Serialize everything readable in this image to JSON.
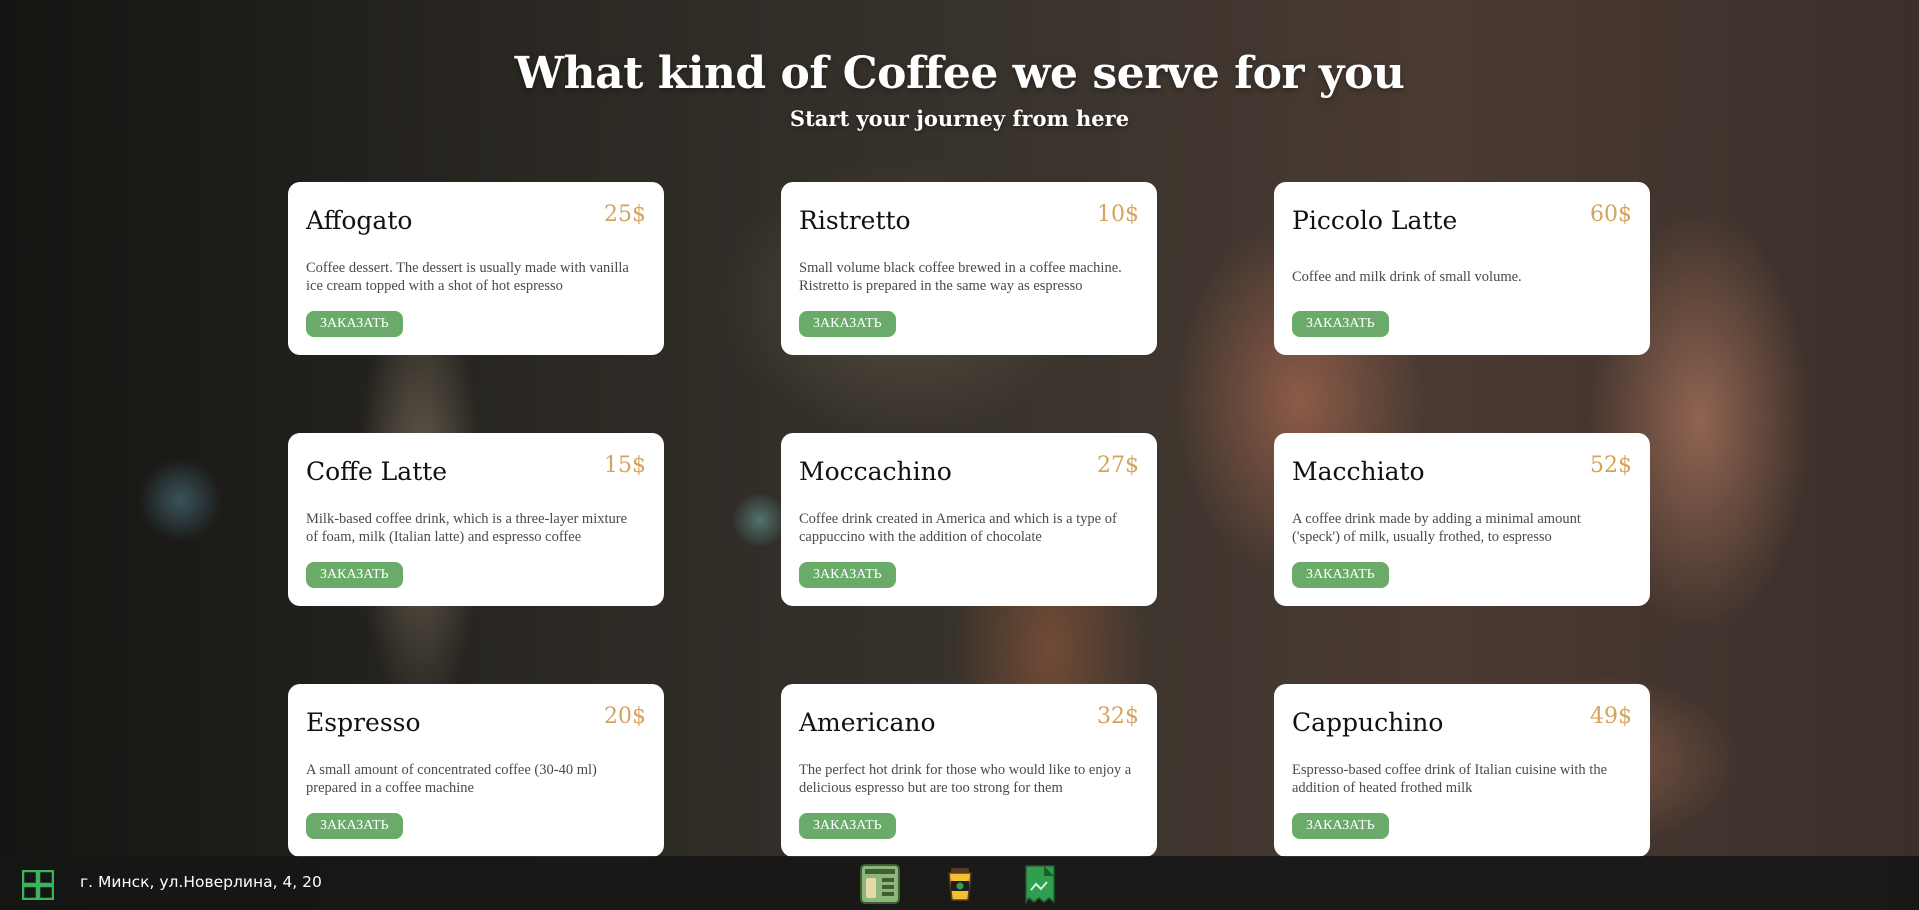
{
  "hero": {
    "title": "What kind of Coffee we serve for you",
    "subtitle": "Start your journey from here"
  },
  "menu": [
    {
      "name": "Affogato",
      "price": "25$",
      "description": "Coffee dessert. The dessert is usually made with vanilla ice cream topped with a shot of hot espresso",
      "button": "ЗАКАЗАТЬ"
    },
    {
      "name": "Ristretto",
      "price": "10$",
      "description": "Small volume black coffee brewed in a coffee machine. Ristretto is prepared in the same way as espresso",
      "button": "ЗАКАЗАТЬ"
    },
    {
      "name": "Piccolo Latte",
      "price": "60$",
      "description": "Coffee and milk drink of small volume.",
      "button": "ЗАКАЗАТЬ"
    },
    {
      "name": "Coffe Latte",
      "price": "15$",
      "description": "Milk-based coffee drink, which is a three-layer mixture of foam, milk (Italian latte) and espresso coffee",
      "button": "ЗАКАЗАТЬ"
    },
    {
      "name": "Moccachino",
      "price": "27$",
      "description": "Coffee drink created in America and which is a type of cappuccino with the addition of chocolate",
      "button": "ЗАКАЗАТЬ"
    },
    {
      "name": "Macchiato",
      "price": "52$",
      "description": "A coffee drink made by adding a minimal amount ('speck') of milk, usually frothed, to espresso",
      "button": "ЗАКАЗАТЬ"
    },
    {
      "name": "Espresso",
      "price": "20$",
      "description": "A small amount of concentrated coffee (30-40 ml) prepared in a coffee machine",
      "button": "ЗАКАЗАТЬ"
    },
    {
      "name": "Americano",
      "price": "32$",
      "description": "The perfect hot drink for those who would like to enjoy a delicious espresso but are too strong for them",
      "button": "ЗАКАЗАТЬ"
    },
    {
      "name": "Cappuchino",
      "price": "49$",
      "description": "Espresso-based coffee drink of Italian cuisine with the addition of heated frothed milk",
      "button": "ЗАКАЗАТЬ"
    }
  ],
  "taskbar": {
    "address": "г. Минск, ул.Новерлина, 4, 20",
    "icons": [
      "start-menu-icon",
      "menu-board-icon",
      "coffee-cup-icon",
      "receipt-icon"
    ]
  },
  "colors": {
    "price": "#d4a35c",
    "button": "#6aab6a",
    "icon_green": "#2f9e4f"
  }
}
